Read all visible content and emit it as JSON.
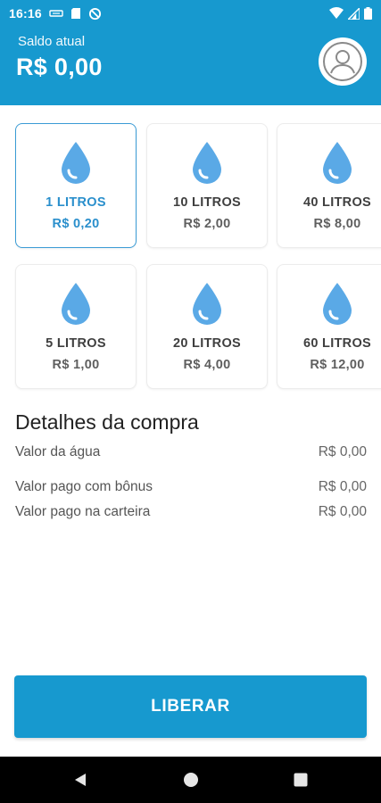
{
  "status_bar": {
    "time": "16:16",
    "icons": [
      "sim-icon",
      "sd-card-icon",
      "vpn-icon",
      "wifi-icon",
      "signal-icon",
      "battery-icon"
    ]
  },
  "header": {
    "balance_label": "Saldo atual",
    "balance_value": "R$ 0,00",
    "avatar_icon": "user-avatar-icon"
  },
  "products": [
    {
      "liters": "1 LITROS",
      "price": "R$ 0,20",
      "selected": true
    },
    {
      "liters": "10 LITROS",
      "price": "R$ 2,00",
      "selected": false
    },
    {
      "liters": "40 LITROS",
      "price": "R$ 8,00",
      "selected": false
    },
    {
      "liters": "5 LITROS",
      "price": "R$ 1,00",
      "selected": false
    },
    {
      "liters": "20 LITROS",
      "price": "R$ 4,00",
      "selected": false
    },
    {
      "liters": "60 LITROS",
      "price": "R$ 12,00",
      "selected": false
    }
  ],
  "details": {
    "title": "Detalhes da compra",
    "rows": [
      {
        "label": "Valor da água",
        "value": "R$ 0,00"
      },
      {
        "label": "Valor pago com bônus",
        "value": "R$ 0,00"
      },
      {
        "label": "Valor pago na carteira",
        "value": "R$ 0,00"
      }
    ]
  },
  "action": {
    "label": "LIBERAR"
  },
  "colors": {
    "primary": "#1799cf",
    "drop": "#5aa9e6",
    "selected_text": "#2a8fcc"
  },
  "nav": {
    "icons": [
      "back-icon",
      "home-icon",
      "recents-icon"
    ]
  }
}
